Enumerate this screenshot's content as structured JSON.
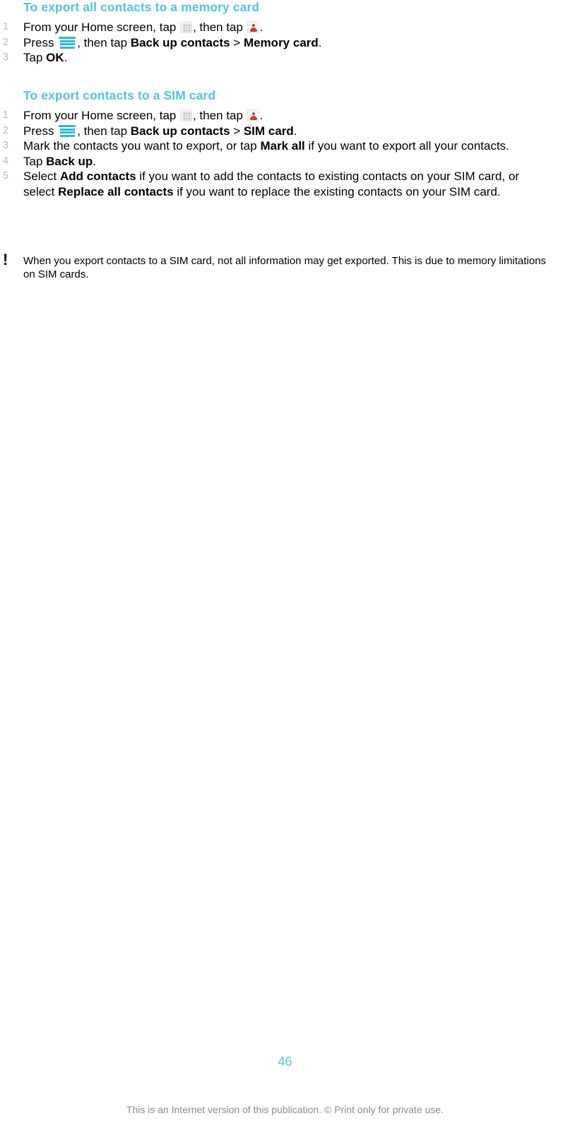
{
  "document": {
    "page_number": "46",
    "footer_note": "This is an Internet version of this publication. © Print only for private use.",
    "accent_color": "#51c3e0",
    "number_color": "#b9b9b9",
    "menu_icon_color": "#2cb8d4",
    "contacts_icon_color": "#d5372a"
  },
  "sections": [
    {
      "heading": "To export all contacts to a memory card",
      "steps": [
        {
          "number": "1",
          "parts": [
            {
              "type": "text",
              "value": "From your Home screen, tap "
            },
            {
              "type": "icon",
              "value": "app-grid-icon"
            },
            {
              "type": "text",
              "value": ", then tap "
            },
            {
              "type": "icon",
              "value": "contacts-icon"
            },
            {
              "type": "text",
              "value": "."
            }
          ]
        },
        {
          "number": "2",
          "parts": [
            {
              "type": "text",
              "value": "Press "
            },
            {
              "type": "icon",
              "value": "menu-icon"
            },
            {
              "type": "text",
              "value": ", then tap "
            },
            {
              "type": "bold",
              "value": "Back up contacts"
            },
            {
              "type": "text",
              "value": " > "
            },
            {
              "type": "bold",
              "value": "Memory card"
            },
            {
              "type": "text",
              "value": "."
            }
          ]
        },
        {
          "number": "3",
          "parts": [
            {
              "type": "text",
              "value": "Tap "
            },
            {
              "type": "bold",
              "value": "OK"
            },
            {
              "type": "text",
              "value": "."
            }
          ]
        }
      ]
    },
    {
      "heading": "To export contacts to a SIM card",
      "steps": [
        {
          "number": "1",
          "parts": [
            {
              "type": "text",
              "value": "From your Home screen, tap "
            },
            {
              "type": "icon",
              "value": "app-grid-icon"
            },
            {
              "type": "text",
              "value": ", then tap "
            },
            {
              "type": "icon",
              "value": "contacts-icon"
            },
            {
              "type": "text",
              "value": "."
            }
          ]
        },
        {
          "number": "2",
          "parts": [
            {
              "type": "text",
              "value": "Press "
            },
            {
              "type": "icon",
              "value": "menu-icon"
            },
            {
              "type": "text",
              "value": ", then tap "
            },
            {
              "type": "bold",
              "value": "Back up contacts"
            },
            {
              "type": "text",
              "value": " > "
            },
            {
              "type": "bold",
              "value": "SIM card"
            },
            {
              "type": "text",
              "value": "."
            }
          ]
        },
        {
          "number": "3",
          "parts": [
            {
              "type": "text",
              "value": "Mark the contacts you want to export, or tap "
            },
            {
              "type": "bold",
              "value": "Mark all"
            },
            {
              "type": "text",
              "value": " if you want to export all your contacts."
            }
          ]
        },
        {
          "number": "4",
          "parts": [
            {
              "type": "text",
              "value": "Tap "
            },
            {
              "type": "bold",
              "value": "Back up"
            },
            {
              "type": "text",
              "value": "."
            }
          ]
        },
        {
          "number": "5",
          "parts": [
            {
              "type": "text",
              "value": "Select "
            },
            {
              "type": "bold",
              "value": "Add contacts"
            },
            {
              "type": "text",
              "value": " if you want to add the contacts to existing contacts on your SIM card, or select "
            },
            {
              "type": "bold",
              "value": "Replace all contacts"
            },
            {
              "type": "text",
              "value": " if you want to replace the existing contacts on your SIM card."
            }
          ]
        }
      ]
    }
  ],
  "note": {
    "icon": "exclamation-icon",
    "marker": "!",
    "text": "When you export contacts to a SIM card, not all information may get exported. This is due to memory limitations on SIM cards."
  }
}
